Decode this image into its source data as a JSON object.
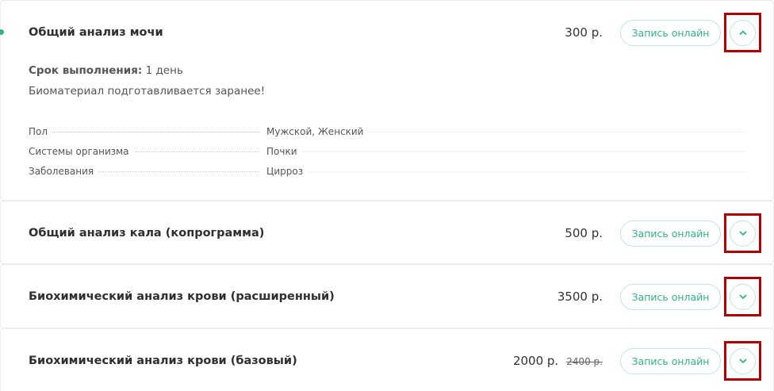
{
  "items": [
    {
      "title": "Общий анализ мочи",
      "price": "300 р.",
      "book_label": "Запись онлайн",
      "expanded": true,
      "term_label": "Срок выполнения:",
      "term_value": "1 день",
      "note": "Биоматериал подготавливается заранее!",
      "attributes": [
        {
          "label": "Пол",
          "value": "Мужской, Женский"
        },
        {
          "label": "Системы организма",
          "value": "Почки"
        },
        {
          "label": "Заболевания",
          "value": "Цирроз"
        }
      ]
    },
    {
      "title": "Общий анализ кала (копрограмма)",
      "price": "500 р.",
      "book_label": "Запись онлайн",
      "expanded": false
    },
    {
      "title": "Биохимический анализ крови (расширенный)",
      "price": "3500 р.",
      "book_label": "Запись онлайн",
      "expanded": false
    },
    {
      "title": "Биохимический анализ крови (базовый)",
      "price": "2000 р.",
      "old_price": "2400 р.",
      "book_label": "Запись онлайн",
      "expanded": false
    }
  ],
  "icons": {
    "expanded": "chevron-up-icon",
    "collapsed": "chevron-down-icon"
  },
  "colors": {
    "accent": "#2fb487",
    "highlight_frame": "#b00000",
    "border": "#ececec"
  }
}
